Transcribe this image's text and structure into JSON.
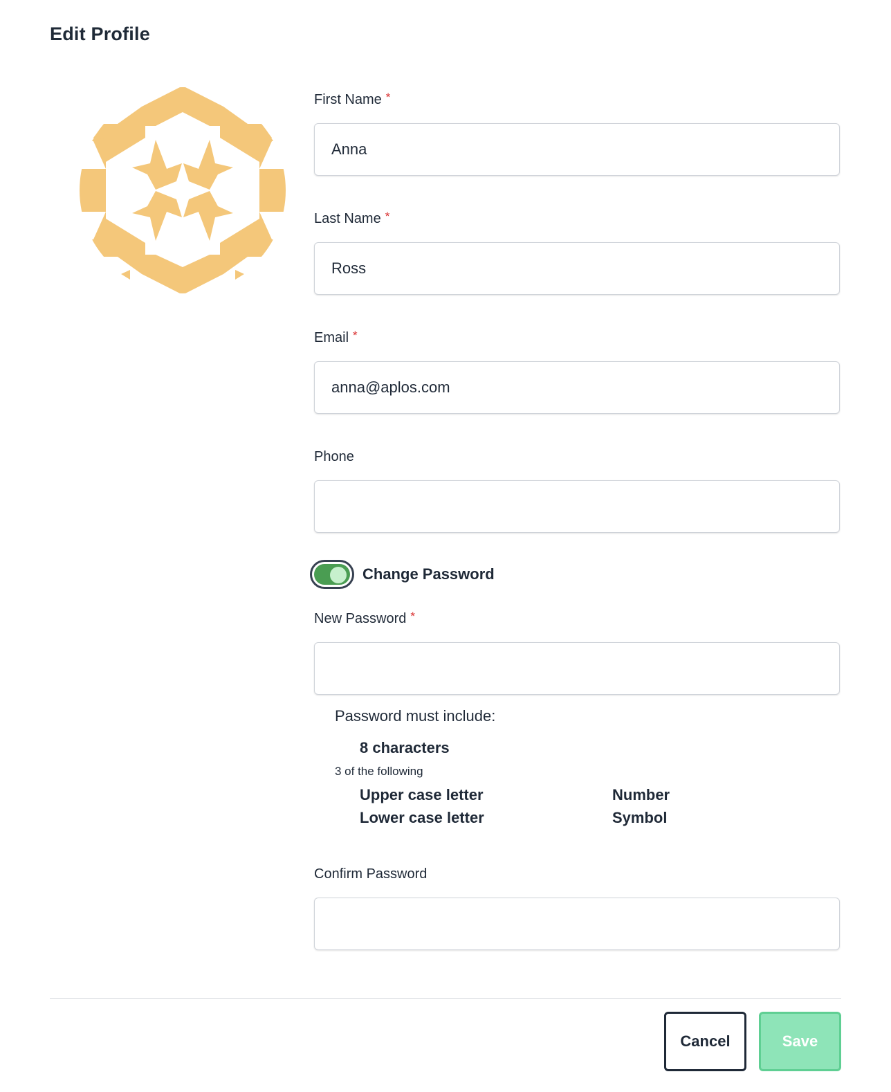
{
  "page": {
    "title": "Edit Profile"
  },
  "avatar": {
    "icon": "identicon-avatar",
    "color": "#f4c77a"
  },
  "form": {
    "first_name": {
      "label": "First Name",
      "required_mark": "*",
      "value": "Anna"
    },
    "last_name": {
      "label": "Last Name",
      "required_mark": "*",
      "value": "Ross"
    },
    "email": {
      "label": "Email",
      "required_mark": "*",
      "value": "anna@aplos.com"
    },
    "phone": {
      "label": "Phone",
      "value": ""
    },
    "change_password": {
      "label": "Change Password",
      "enabled": true,
      "track_color": "#4a9d52"
    },
    "new_password": {
      "label": "New Password",
      "required_mark": "*",
      "value": ""
    },
    "password_rules": {
      "title": "Password must include:",
      "min_length": "8 characters",
      "subtitle": "3 of the following",
      "items": [
        "Upper case letter",
        "Number",
        "Lower case letter",
        "Symbol"
      ]
    },
    "confirm_password": {
      "label": "Confirm Password",
      "value": ""
    }
  },
  "actions": {
    "cancel_label": "Cancel",
    "save_label": "Save",
    "save_color": "#8ee4b8"
  }
}
